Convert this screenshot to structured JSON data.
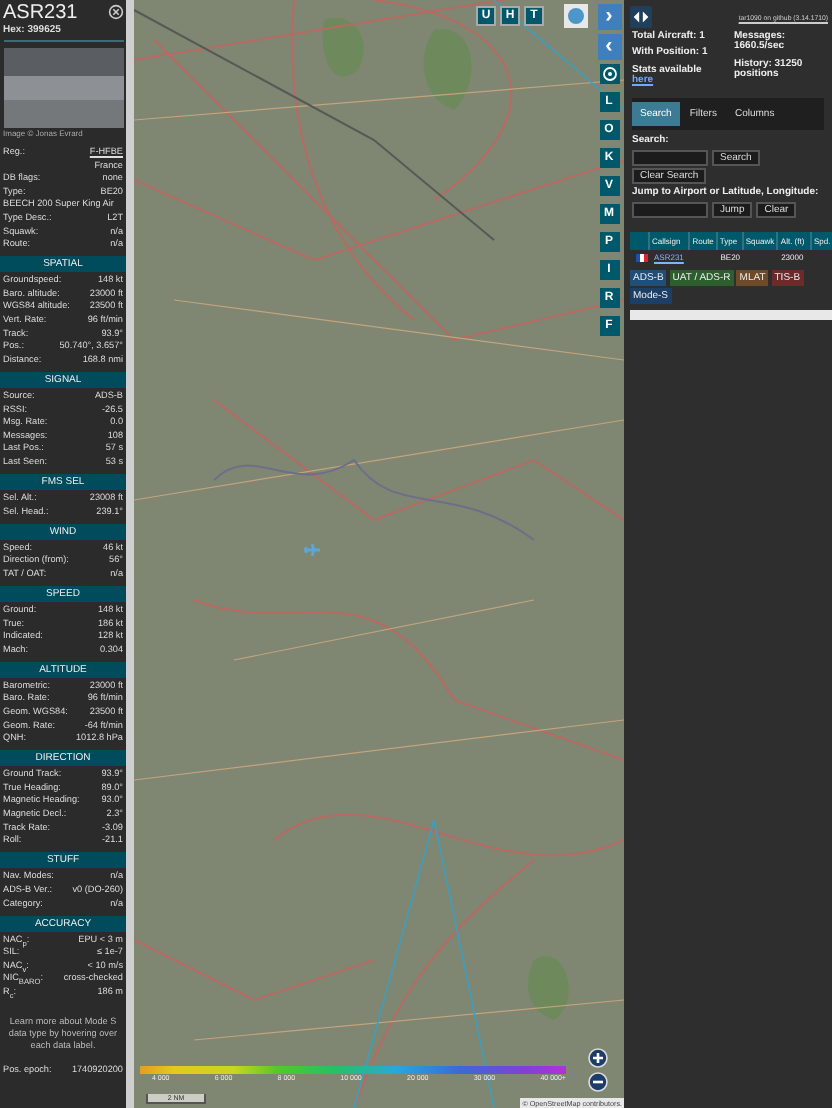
{
  "aircraft_panel": {
    "callsign": "ASR231",
    "hex": "Hex: 399625",
    "photo_credit": "Image © Jonas Evrard",
    "info_rows": [
      {
        "label": "Reg.:",
        "value": "F-HFBE",
        "kind": "link"
      },
      {
        "label": "",
        "value": "France",
        "kind": "text"
      },
      {
        "label": "DB flags:",
        "value": "none",
        "kind": "text"
      },
      {
        "label": "Type:",
        "value": "BE20",
        "kind": "text"
      },
      {
        "label": "",
        "value": "BEECH 200 Super King Air",
        "kind": "wide"
      },
      {
        "label": "Type Desc.:",
        "value": "L2T",
        "kind": "text"
      },
      {
        "label": "Squawk:",
        "value": "n/a",
        "kind": "text"
      },
      {
        "label": "Route:",
        "value": "n/a",
        "kind": "text"
      }
    ],
    "sections": [
      {
        "title": "SPATIAL",
        "rows": [
          {
            "label": "Groundspeed:",
            "value": "148 kt"
          },
          {
            "label": "Baro. altitude:",
            "value": "23000 ft"
          },
          {
            "label": "WGS84 altitude:",
            "value": "23500 ft"
          },
          {
            "label": "Vert. Rate:",
            "value": "96 ft/min"
          },
          {
            "label": "Track:",
            "value": "93.9°"
          },
          {
            "label": "Pos.:",
            "value": "50.740°, 3.657°"
          },
          {
            "label": "Distance:",
            "value": "168.8 nmi"
          }
        ]
      },
      {
        "title": "SIGNAL",
        "rows": [
          {
            "label": "Source:",
            "value": "ADS-B"
          },
          {
            "label": "RSSI:",
            "value": "-26.5"
          },
          {
            "label": "Msg. Rate:",
            "value": "0.0"
          },
          {
            "label": "Messages:",
            "value": "108"
          },
          {
            "label": "Last Pos.:",
            "value": "57 s"
          },
          {
            "label": "Last Seen:",
            "value": "53 s"
          }
        ]
      },
      {
        "title": "FMS SEL",
        "rows": [
          {
            "label": "Sel. Alt.:",
            "value": "23008 ft"
          },
          {
            "label": "Sel. Head.:",
            "value": "239.1°"
          }
        ]
      },
      {
        "title": "WIND",
        "rows": [
          {
            "label": "Speed:",
            "value": "46 kt"
          },
          {
            "label": "Direction (from):",
            "value": "56°"
          },
          {
            "label": "TAT / OAT:",
            "value": "n/a"
          }
        ]
      },
      {
        "title": "SPEED",
        "rows": [
          {
            "label": "Ground:",
            "value": "148 kt"
          },
          {
            "label": "True:",
            "value": "186 kt"
          },
          {
            "label": "Indicated:",
            "value": "128 kt"
          },
          {
            "label": "Mach:",
            "value": "0.304"
          }
        ]
      },
      {
        "title": "ALTITUDE",
        "rows": [
          {
            "label": "Barometric:",
            "value": "23000 ft"
          },
          {
            "label": "Baro. Rate:",
            "value": "96 ft/min"
          },
          {
            "label": "Geom. WGS84:",
            "value": "23500 ft"
          },
          {
            "label": "Geom. Rate:",
            "value": "-64 ft/min"
          },
          {
            "label": "QNH:",
            "value": "1012.8 hPa"
          }
        ]
      },
      {
        "title": "DIRECTION",
        "rows": [
          {
            "label": "Ground Track:",
            "value": "93.9°"
          },
          {
            "label": "True Heading:",
            "value": "89.0°"
          },
          {
            "label": "Magnetic Heading:",
            "value": "93.0°"
          },
          {
            "label": "Magnetic Decl.:",
            "value": "2.3°"
          },
          {
            "label": "Track Rate:",
            "value": "-3.09"
          },
          {
            "label": "Roll:",
            "value": "-21.1"
          }
        ]
      },
      {
        "title": "STUFF",
        "rows": [
          {
            "label": "Nav. Modes:",
            "value": "n/a"
          },
          {
            "label": "ADS-B Ver.:",
            "value": "v0 (DO-260)"
          },
          {
            "label": "Category:",
            "value": "n/a"
          }
        ]
      },
      {
        "title": "ACCURACY",
        "rows": [
          {
            "label": "NAC$_{p}$:",
            "value": "EPU < 3 m"
          },
          {
            "label": "SIL:",
            "value": "≤ 1e-7"
          },
          {
            "label": "NAC$_{v}$:",
            "value": "< 10 m/s"
          },
          {
            "label": "NIC$_{BARO}$:",
            "value": "cross-checked"
          },
          {
            "label": "R$_{c}$:",
            "value": "186 m"
          }
        ]
      }
    ],
    "help_text": "Learn more about Mode S data type by hovering over each data label.",
    "epoch": {
      "label": "Pos. epoch:",
      "value": "1740920200"
    }
  },
  "map": {
    "top_buttons": [
      "U",
      "H",
      "T"
    ],
    "side_buttons": [
      {
        "label": "›",
        "kind": "nav"
      },
      {
        "label": "‹",
        "kind": "nav"
      },
      {
        "kind": "icon"
      },
      {
        "label": "L",
        "kind": "letter"
      },
      {
        "label": "O",
        "kind": "letter"
      },
      {
        "label": "K",
        "kind": "letter"
      },
      {
        "label": "V",
        "kind": "letter"
      },
      {
        "label": "M",
        "kind": "letter"
      },
      {
        "label": "P",
        "kind": "letter"
      },
      {
        "label": "I",
        "kind": "letter"
      },
      {
        "label": "R",
        "kind": "letter"
      },
      {
        "label": "F",
        "kind": "letter"
      }
    ],
    "legend": [
      "4 000",
      "6 000",
      "8 000",
      "10 000",
      "20 000",
      "30 000",
      "40 000+"
    ],
    "scale": "2 NM",
    "attribution": "© OpenStreetMap contributors."
  },
  "sidebar": {
    "version_link": "tar1090 on github (3.14.1710)",
    "stats_left": [
      "Total Aircraft: 1",
      "With Position: 1"
    ],
    "stats_right": [
      "Messages: 1660.5/sec",
      "History: 31250 positions"
    ],
    "stats_note": "Stats available",
    "stats_link": "here",
    "tabs": [
      {
        "label": "Search",
        "selected": true
      },
      {
        "label": "Filters",
        "selected": false
      },
      {
        "label": "Columns",
        "selected": false
      }
    ],
    "search_label": "Search:",
    "search_button": "Search",
    "clear_search_button": "Clear Search",
    "jump_label": "Jump to Airport or Latitude, Longitude:",
    "jump_button": "Jump",
    "clear_button": "Clear",
    "table": {
      "columns": [
        "Callsign",
        "Route",
        "Type",
        "Squawk",
        "Alt. (ft)",
        "Spd."
      ],
      "rows": [
        {
          "callsign": "ASR231",
          "type": "BE20",
          "altitude": "23000"
        }
      ]
    },
    "tags": [
      {
        "label": "ADS-B",
        "color": "#1f4e79"
      },
      {
        "label": "UAT / ADS-R",
        "color": "#2d5e2d"
      },
      {
        "label": "MLAT",
        "color": "#6e4a28"
      },
      {
        "label": "TIS-B",
        "color": "#6b2b2b"
      },
      {
        "label": "Mode-S",
        "color": "#1c3f66"
      }
    ]
  }
}
